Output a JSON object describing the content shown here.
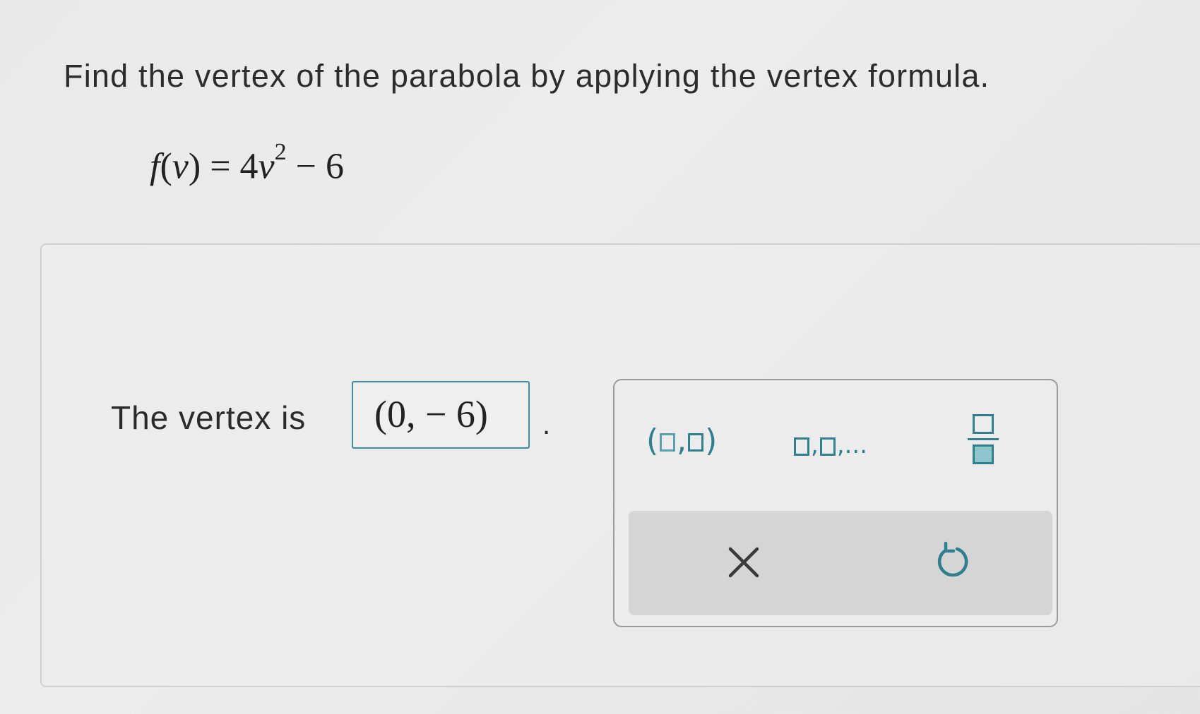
{
  "question": {
    "prompt": "Find the vertex of the parabola by applying the vertex formula.",
    "equation": {
      "fn": "f",
      "open": "(",
      "var": "v",
      "close": ")",
      "eq": " = 4",
      "var2": "v",
      "exp": "2",
      "rest": " − 6"
    }
  },
  "answer": {
    "label": "The vertex is",
    "value": "(0, − 6)",
    "suffix": "."
  },
  "palette": {
    "pair_open": "(",
    "pair_comma": ",",
    "pair_close": ")",
    "list_comma": ",",
    "list_tail": ",..."
  },
  "icons": {
    "clear": "close-icon",
    "reset": "undo-icon"
  },
  "colors": {
    "accent": "#2f7f8f",
    "answer_border": "#3d8e9a"
  }
}
